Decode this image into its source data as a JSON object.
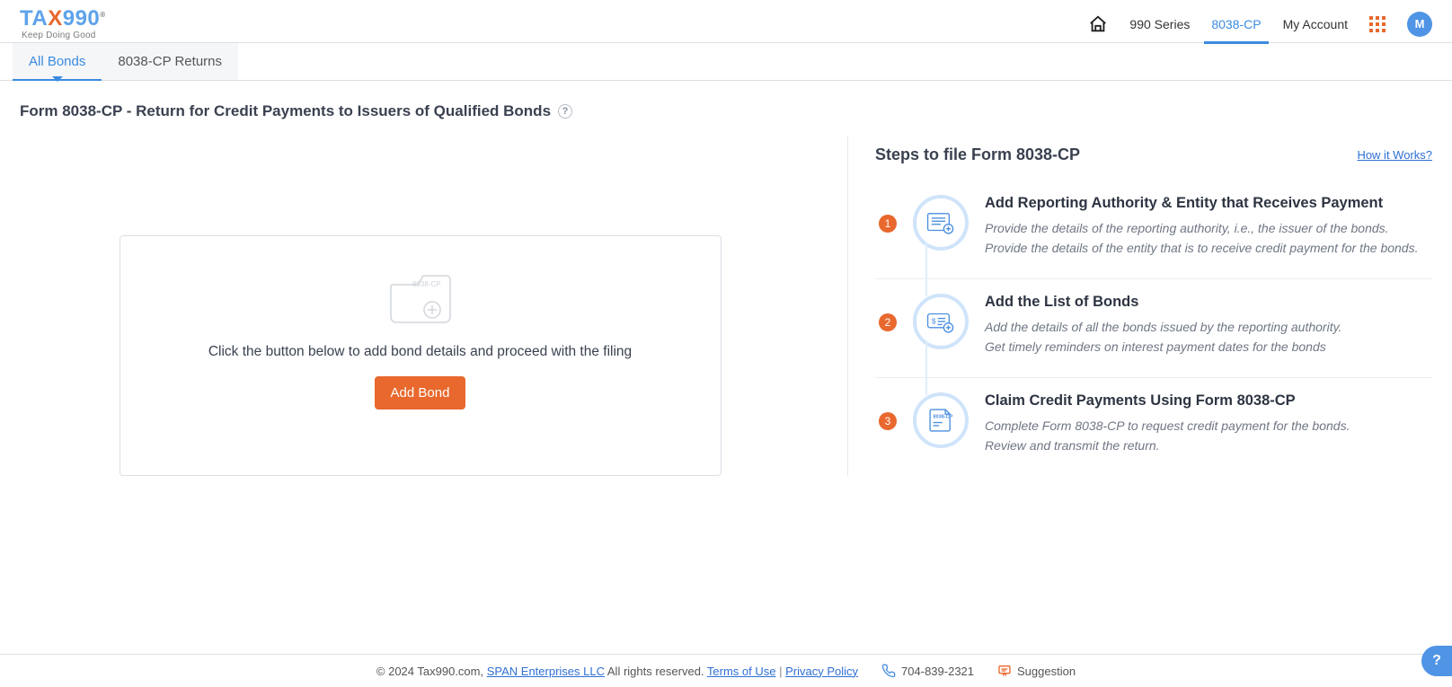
{
  "header": {
    "logo_main": "TAX990",
    "logo_sub": "Keep Doing Good",
    "nav": {
      "series": "990 Series",
      "cp": "8038-CP",
      "account": "My Account"
    },
    "avatar_initial": "M"
  },
  "tabs": {
    "all_bonds": "All Bonds",
    "returns": "8038-CP Returns"
  },
  "page_title": "Form 8038-CP - Return for Credit Payments to Issuers of Qualified Bonds",
  "empty": {
    "folder_label": "8038-CP",
    "text": "Click the button below to add bond details and proceed with the filing",
    "button": "Add Bond"
  },
  "steps_panel": {
    "title": "Steps to file Form 8038-CP",
    "how_link": "How it Works?",
    "steps": [
      {
        "num": "1",
        "title": "Add Reporting Authority & Entity that Receives Payment",
        "line1": "Provide the details of the reporting authority, i.e., the issuer of the bonds.",
        "line2": "Provide the details of the entity that is to receive credit payment for the bonds."
      },
      {
        "num": "2",
        "title": "Add the List of Bonds",
        "line1": "Add the details of all the bonds issued by the reporting authority.",
        "line2": "Get timely reminders on interest payment dates for the bonds"
      },
      {
        "num": "3",
        "title": "Claim Credit Payments Using Form 8038-CP",
        "line1": "Complete Form 8038-CP to request credit payment for the bonds.",
        "line2": "Review and transmit the return."
      }
    ]
  },
  "footer": {
    "copyright_pre": "© 2024 Tax990.com, ",
    "span_link": "SPAN Enterprises LLC",
    "copyright_post": " All rights reserved. ",
    "terms": "Terms of Use",
    "privacy": "Privacy Policy",
    "phone": "704-839-2321",
    "suggestion": "Suggestion"
  },
  "step_icon_label": "8038-CP"
}
